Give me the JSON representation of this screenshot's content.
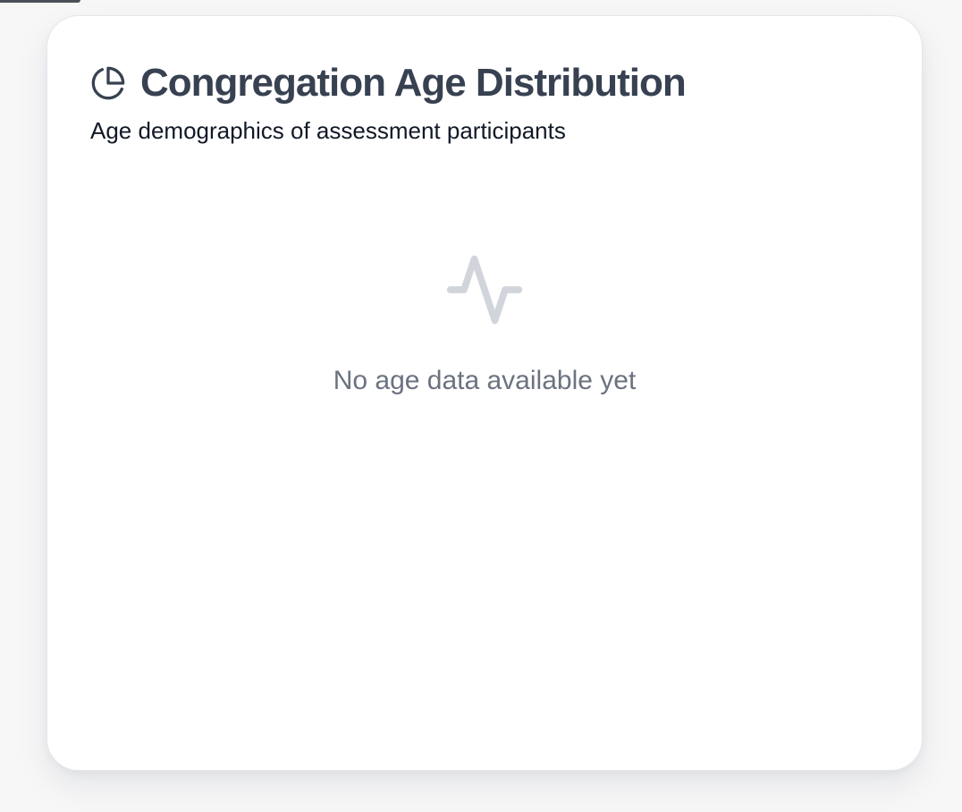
{
  "card": {
    "title": "Congregation Age Distribution",
    "subtitle": "Age demographics of assessment participants",
    "title_icon": "pie-chart-icon",
    "empty_state": {
      "icon": "activity-icon",
      "message": "No age data available yet"
    }
  },
  "colors": {
    "title": "#374151",
    "subtitle": "#111827",
    "empty_text": "#6b7280",
    "empty_icon": "#d1d5db",
    "card_border": "#e5e7eb",
    "background": "#f7f7f8"
  }
}
